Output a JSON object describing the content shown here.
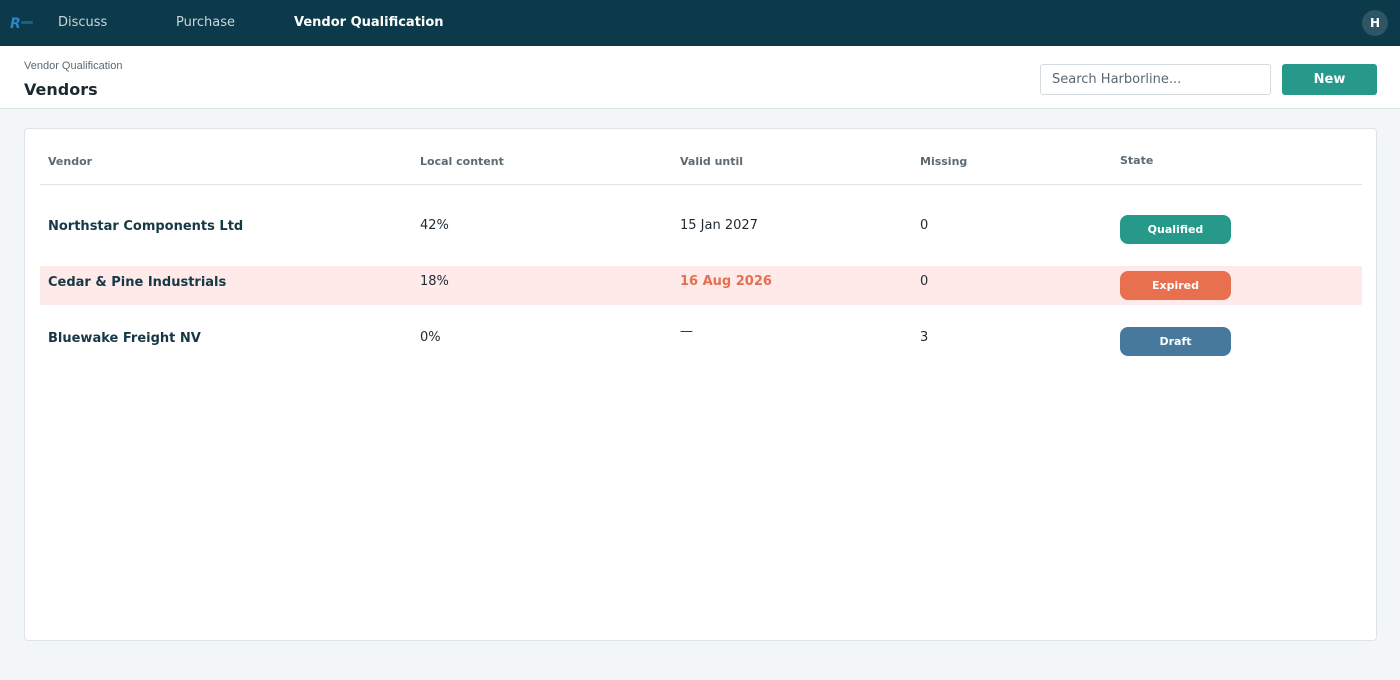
{
  "nav": {
    "items": [
      {
        "label": "Discuss"
      },
      {
        "label": "Purchase"
      },
      {
        "label": "Vendor Qualification"
      }
    ],
    "avatar_initial": "H"
  },
  "header": {
    "breadcrumb": "Vendor Qualification",
    "title": "Vendors",
    "search_placeholder": "Search Harborline...",
    "new_label": "New"
  },
  "table": {
    "columns": [
      "Vendor",
      "Local content",
      "Valid until",
      "Missing",
      "State"
    ],
    "rows": [
      {
        "vendor": "Northstar Components Ltd",
        "local_content": "42%",
        "valid_until": "15 Jan 2027",
        "missing": "0",
        "state": "Qualified"
      },
      {
        "vendor": "Cedar & Pine Industrials",
        "local_content": "18%",
        "valid_until": "16 Aug 2026",
        "missing": "0",
        "state": "Expired"
      },
      {
        "vendor": "Bluewake Freight NV",
        "local_content": "0%",
        "valid_until": "—",
        "missing": "3",
        "state": "Draft"
      }
    ]
  },
  "colors": {
    "nav_bg": "#0c3a4a",
    "accent": "#26998a",
    "qualified": "#26998a",
    "expired": "#e8704f",
    "draft": "#46799c",
    "expired_row_bg": "#ffeaea"
  }
}
